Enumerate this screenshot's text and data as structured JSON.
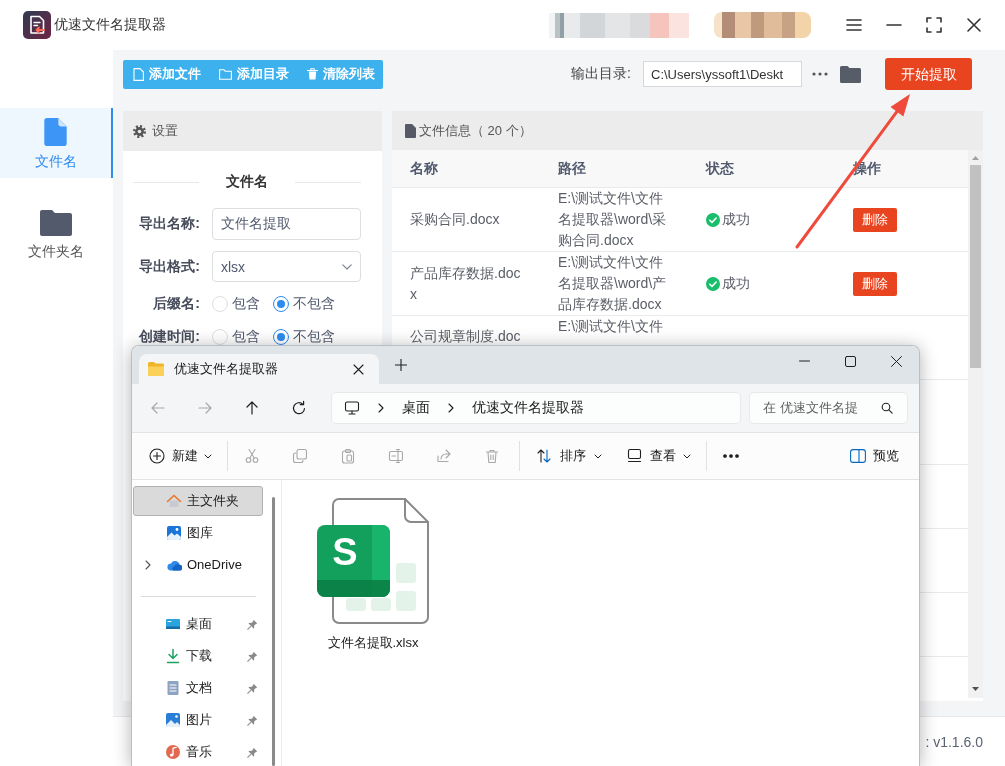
{
  "window": {
    "title": "优速文件名提取器"
  },
  "sidebar": {
    "items": [
      {
        "label": "文件名",
        "kind": "file",
        "selected": true
      },
      {
        "label": "文件夹名",
        "kind": "folder",
        "selected": false
      }
    ]
  },
  "toolbar": {
    "buttons": [
      {
        "label": "添加文件",
        "kind": "file"
      },
      {
        "label": "添加目录",
        "kind": "folder"
      },
      {
        "label": "清除列表",
        "kind": "trash"
      }
    ],
    "output_label": "输出目录:",
    "output_path": "C:\\Users\\yssoft1\\Deskt",
    "start_button": "开始提取"
  },
  "settings": {
    "title": "设置",
    "section": "文件名",
    "fields": [
      {
        "kind": "text",
        "label": "导出名称:",
        "value": "文件名提取"
      },
      {
        "kind": "select",
        "label": "导出格式:",
        "value": "xlsx"
      },
      {
        "kind": "radio",
        "label": "后缀名:",
        "options": [
          {
            "label": "包含",
            "selected": false
          },
          {
            "label": "不包含",
            "selected": true
          }
        ]
      },
      {
        "kind": "radio",
        "label": "创建时间:",
        "options": [
          {
            "label": "包含",
            "selected": false
          },
          {
            "label": "不包含",
            "selected": true
          }
        ]
      }
    ]
  },
  "files": {
    "title": "文件信息（ 20 个）",
    "columns": [
      "名称",
      "路径",
      "状态",
      "操作"
    ],
    "rows": [
      {
        "name": "采购合同.docx",
        "path": "E:\\测试文件\\文件名提取器\\word\\采购合同.docx",
        "kind": "success",
        "status_text": "成功",
        "action": "删除"
      },
      {
        "name": "产品库存数据.docx",
        "path": "E:\\测试文件\\文件名提取器\\word\\产品库存数据.docx",
        "kind": "success",
        "status_text": "成功",
        "action": "删除"
      },
      {
        "name": "公司规章制度.doc",
        "path": "E:\\测试文件\\文件"
      }
    ]
  },
  "status_bar": {
    "version": ": v1.1.6.0"
  },
  "explorer": {
    "tab": {
      "title": "优速文件名提取器",
      "selected": true
    },
    "nav_buttons": [
      {
        "kind": "back",
        "disabled": true
      },
      {
        "kind": "forward",
        "disabled": true
      },
      {
        "kind": "up",
        "disabled": false
      },
      {
        "kind": "refresh",
        "disabled": false
      }
    ],
    "breadcrumbs": [
      "桌面",
      "优速文件名提取器"
    ],
    "search": {
      "placeholder": "在 优速文件名提"
    },
    "command_groups": [
      [
        {
          "kind": "new",
          "label": "新建",
          "disabled": false
        }
      ],
      [
        {
          "kind": "cut",
          "disabled": true
        },
        {
          "kind": "copy",
          "disabled": true
        },
        {
          "kind": "paste",
          "disabled": true
        },
        {
          "kind": "rename",
          "disabled": true
        },
        {
          "kind": "share",
          "disabled": true
        },
        {
          "kind": "delete",
          "disabled": true
        }
      ],
      [
        {
          "kind": "sort",
          "label": "排序",
          "disabled": false
        },
        {
          "kind": "view",
          "label": "查看",
          "disabled": false
        }
      ],
      [
        {
          "kind": "more",
          "disabled": false
        }
      ]
    ],
    "preview": {
      "label": "预览"
    },
    "nav": [
      {
        "label": "主文件夹",
        "kind": "home",
        "selected": true
      },
      {
        "label": "图库",
        "kind": "gallery",
        "selected": false
      },
      {
        "label": "OneDrive",
        "kind": "cloud",
        "selected": false,
        "expanded": false
      }
    ],
    "quick_access": [
      {
        "label": "桌面",
        "kind": "desktop",
        "pinned": true,
        "selected": false
      },
      {
        "label": "下载",
        "kind": "download",
        "pinned": true,
        "selected": false
      },
      {
        "label": "文档",
        "kind": "document",
        "pinned": true,
        "selected": false
      },
      {
        "label": "图片",
        "kind": "pictures",
        "pinned": true,
        "selected": false
      },
      {
        "label": "音乐",
        "kind": "music",
        "pinned": true,
        "selected": false
      }
    ],
    "items": [
      {
        "name": "文件名提取.xlsx",
        "kind": "spreadsheet",
        "icon_letter": "S",
        "selected": false
      }
    ]
  }
}
